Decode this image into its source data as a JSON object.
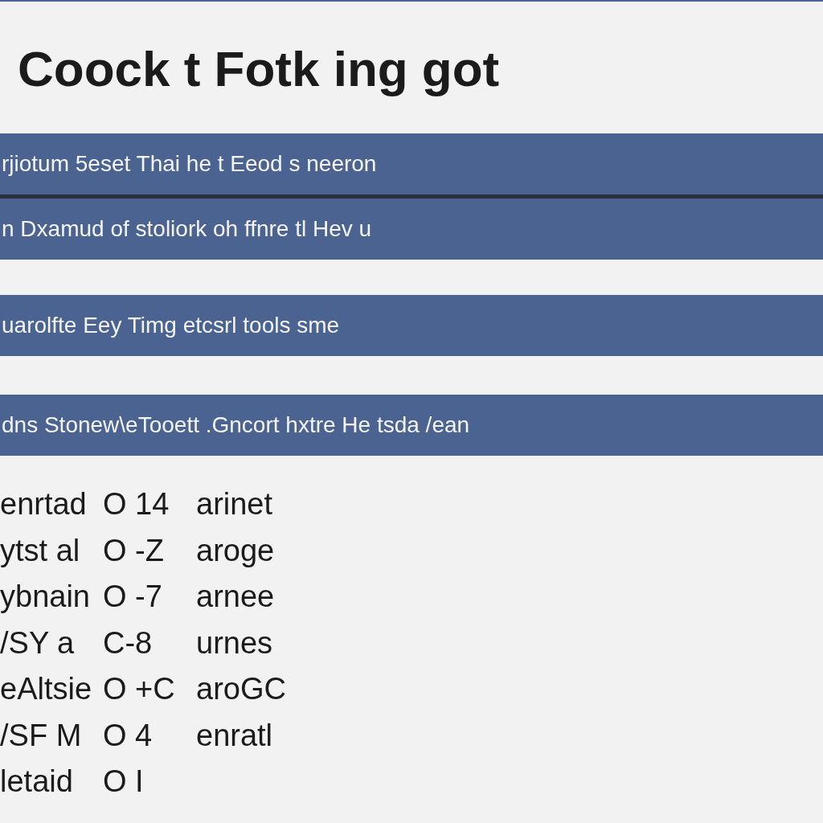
{
  "title": "Coock t Fotk ing got",
  "bars": [
    {
      "text": "rjiotum 5eset Thai he t Eeod s neeron",
      "joined": true
    },
    {
      "text": "n Dxamud of stoliork oh ffnre tl Hev u",
      "joined": false
    },
    {
      "text": "uarolfte Eey Timg etcsrl tools sme",
      "joined": false
    },
    {
      "text": "dns Stonew\\eTooett .Gncort hxtre He tsda /ean",
      "joined": false
    }
  ],
  "rows": [
    {
      "name": "enrtad",
      "code": "O 14",
      "word": "arinet"
    },
    {
      "name": "ytst al",
      "code": "O -Z",
      "word": "aroge"
    },
    {
      "name": "ybnain",
      "code": "O -7",
      "word": "arnee"
    },
    {
      "name": "/SY a",
      "code": "C-8",
      "word": "urnes"
    },
    {
      "name": "eAltsie",
      "code": "O +C",
      "word": "aroGC"
    },
    {
      "name": "/SF M",
      "code": "O 4",
      "word": "enratl"
    },
    {
      "name": "letaid",
      "code": "O I"
    }
  ]
}
